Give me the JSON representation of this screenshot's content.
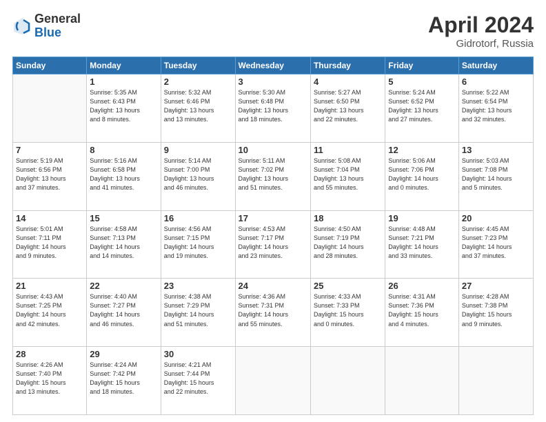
{
  "header": {
    "logo_general": "General",
    "logo_blue": "Blue",
    "month_title": "April 2024",
    "location": "Gidrotorf, Russia"
  },
  "weekdays": [
    "Sunday",
    "Monday",
    "Tuesday",
    "Wednesday",
    "Thursday",
    "Friday",
    "Saturday"
  ],
  "weeks": [
    [
      {
        "day": "",
        "info": ""
      },
      {
        "day": "1",
        "info": "Sunrise: 5:35 AM\nSunset: 6:43 PM\nDaylight: 13 hours\nand 8 minutes."
      },
      {
        "day": "2",
        "info": "Sunrise: 5:32 AM\nSunset: 6:46 PM\nDaylight: 13 hours\nand 13 minutes."
      },
      {
        "day": "3",
        "info": "Sunrise: 5:30 AM\nSunset: 6:48 PM\nDaylight: 13 hours\nand 18 minutes."
      },
      {
        "day": "4",
        "info": "Sunrise: 5:27 AM\nSunset: 6:50 PM\nDaylight: 13 hours\nand 22 minutes."
      },
      {
        "day": "5",
        "info": "Sunrise: 5:24 AM\nSunset: 6:52 PM\nDaylight: 13 hours\nand 27 minutes."
      },
      {
        "day": "6",
        "info": "Sunrise: 5:22 AM\nSunset: 6:54 PM\nDaylight: 13 hours\nand 32 minutes."
      }
    ],
    [
      {
        "day": "7",
        "info": "Sunrise: 5:19 AM\nSunset: 6:56 PM\nDaylight: 13 hours\nand 37 minutes."
      },
      {
        "day": "8",
        "info": "Sunrise: 5:16 AM\nSunset: 6:58 PM\nDaylight: 13 hours\nand 41 minutes."
      },
      {
        "day": "9",
        "info": "Sunrise: 5:14 AM\nSunset: 7:00 PM\nDaylight: 13 hours\nand 46 minutes."
      },
      {
        "day": "10",
        "info": "Sunrise: 5:11 AM\nSunset: 7:02 PM\nDaylight: 13 hours\nand 51 minutes."
      },
      {
        "day": "11",
        "info": "Sunrise: 5:08 AM\nSunset: 7:04 PM\nDaylight: 13 hours\nand 55 minutes."
      },
      {
        "day": "12",
        "info": "Sunrise: 5:06 AM\nSunset: 7:06 PM\nDaylight: 14 hours\nand 0 minutes."
      },
      {
        "day": "13",
        "info": "Sunrise: 5:03 AM\nSunset: 7:08 PM\nDaylight: 14 hours\nand 5 minutes."
      }
    ],
    [
      {
        "day": "14",
        "info": "Sunrise: 5:01 AM\nSunset: 7:11 PM\nDaylight: 14 hours\nand 9 minutes."
      },
      {
        "day": "15",
        "info": "Sunrise: 4:58 AM\nSunset: 7:13 PM\nDaylight: 14 hours\nand 14 minutes."
      },
      {
        "day": "16",
        "info": "Sunrise: 4:56 AM\nSunset: 7:15 PM\nDaylight: 14 hours\nand 19 minutes."
      },
      {
        "day": "17",
        "info": "Sunrise: 4:53 AM\nSunset: 7:17 PM\nDaylight: 14 hours\nand 23 minutes."
      },
      {
        "day": "18",
        "info": "Sunrise: 4:50 AM\nSunset: 7:19 PM\nDaylight: 14 hours\nand 28 minutes."
      },
      {
        "day": "19",
        "info": "Sunrise: 4:48 AM\nSunset: 7:21 PM\nDaylight: 14 hours\nand 33 minutes."
      },
      {
        "day": "20",
        "info": "Sunrise: 4:45 AM\nSunset: 7:23 PM\nDaylight: 14 hours\nand 37 minutes."
      }
    ],
    [
      {
        "day": "21",
        "info": "Sunrise: 4:43 AM\nSunset: 7:25 PM\nDaylight: 14 hours\nand 42 minutes."
      },
      {
        "day": "22",
        "info": "Sunrise: 4:40 AM\nSunset: 7:27 PM\nDaylight: 14 hours\nand 46 minutes."
      },
      {
        "day": "23",
        "info": "Sunrise: 4:38 AM\nSunset: 7:29 PM\nDaylight: 14 hours\nand 51 minutes."
      },
      {
        "day": "24",
        "info": "Sunrise: 4:36 AM\nSunset: 7:31 PM\nDaylight: 14 hours\nand 55 minutes."
      },
      {
        "day": "25",
        "info": "Sunrise: 4:33 AM\nSunset: 7:33 PM\nDaylight: 15 hours\nand 0 minutes."
      },
      {
        "day": "26",
        "info": "Sunrise: 4:31 AM\nSunset: 7:36 PM\nDaylight: 15 hours\nand 4 minutes."
      },
      {
        "day": "27",
        "info": "Sunrise: 4:28 AM\nSunset: 7:38 PM\nDaylight: 15 hours\nand 9 minutes."
      }
    ],
    [
      {
        "day": "28",
        "info": "Sunrise: 4:26 AM\nSunset: 7:40 PM\nDaylight: 15 hours\nand 13 minutes."
      },
      {
        "day": "29",
        "info": "Sunrise: 4:24 AM\nSunset: 7:42 PM\nDaylight: 15 hours\nand 18 minutes."
      },
      {
        "day": "30",
        "info": "Sunrise: 4:21 AM\nSunset: 7:44 PM\nDaylight: 15 hours\nand 22 minutes."
      },
      {
        "day": "",
        "info": ""
      },
      {
        "day": "",
        "info": ""
      },
      {
        "day": "",
        "info": ""
      },
      {
        "day": "",
        "info": ""
      }
    ]
  ]
}
